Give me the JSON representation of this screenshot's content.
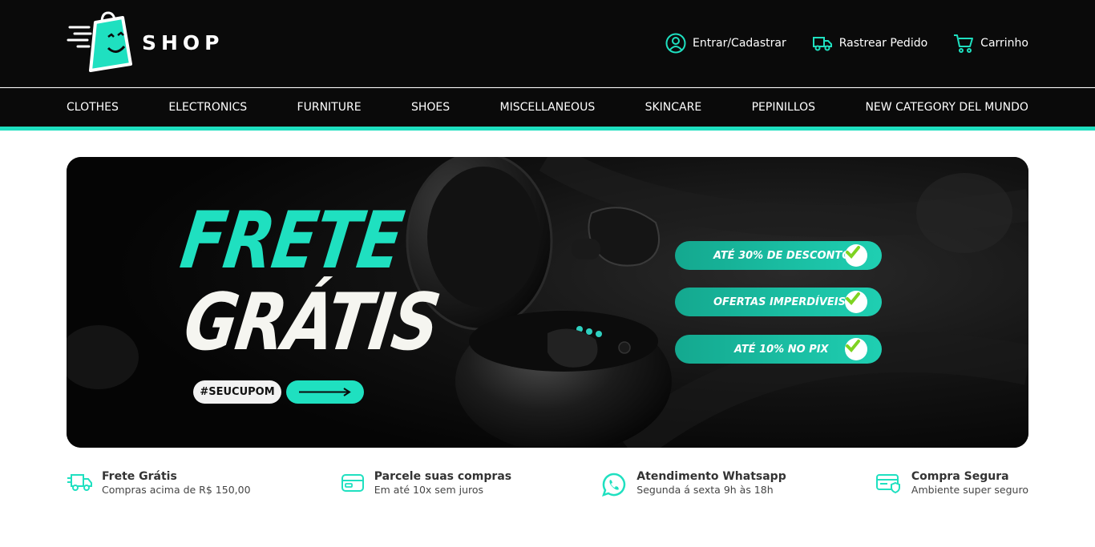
{
  "brand": {
    "name": "SHOP",
    "accent": "#1fe0c0"
  },
  "header": {
    "links": [
      {
        "label": "Entrar/Cadastrar",
        "icon": "user-icon"
      },
      {
        "label": "Rastrear Pedido",
        "icon": "truck-icon"
      },
      {
        "label": "Carrinho",
        "icon": "cart-icon"
      }
    ]
  },
  "categories": [
    "CLOTHES",
    "ELECTRONICS",
    "FURNITURE",
    "SHOES",
    "MISCELLANEOUS",
    "SKINCARE",
    "PEPINILLOS",
    "NEW CATEGORY DEL MUNDO"
  ],
  "banner": {
    "title_line1": "FRETE",
    "title_line2": "GRÁTIS",
    "coupon": "#SEUCUPOM",
    "pills": [
      "ATÉ 30% DE DESCONTO",
      "OFERTAS IMPERDÍVEIS",
      "ATÉ 10% NO PIX"
    ]
  },
  "features": [
    {
      "title": "Frete Grátis",
      "subtitle": "Compras acima de R$ 150,00",
      "icon": "truck-icon"
    },
    {
      "title": "Parcele suas compras",
      "subtitle": "Em até 10x sem juros",
      "icon": "credit-card-icon"
    },
    {
      "title": "Atendimento Whatsapp",
      "subtitle": "Segunda á sexta 9h às 18h",
      "icon": "whatsapp-icon"
    },
    {
      "title": "Compra Segura",
      "subtitle": "Ambiente super seguro",
      "icon": "secure-card-icon"
    }
  ]
}
